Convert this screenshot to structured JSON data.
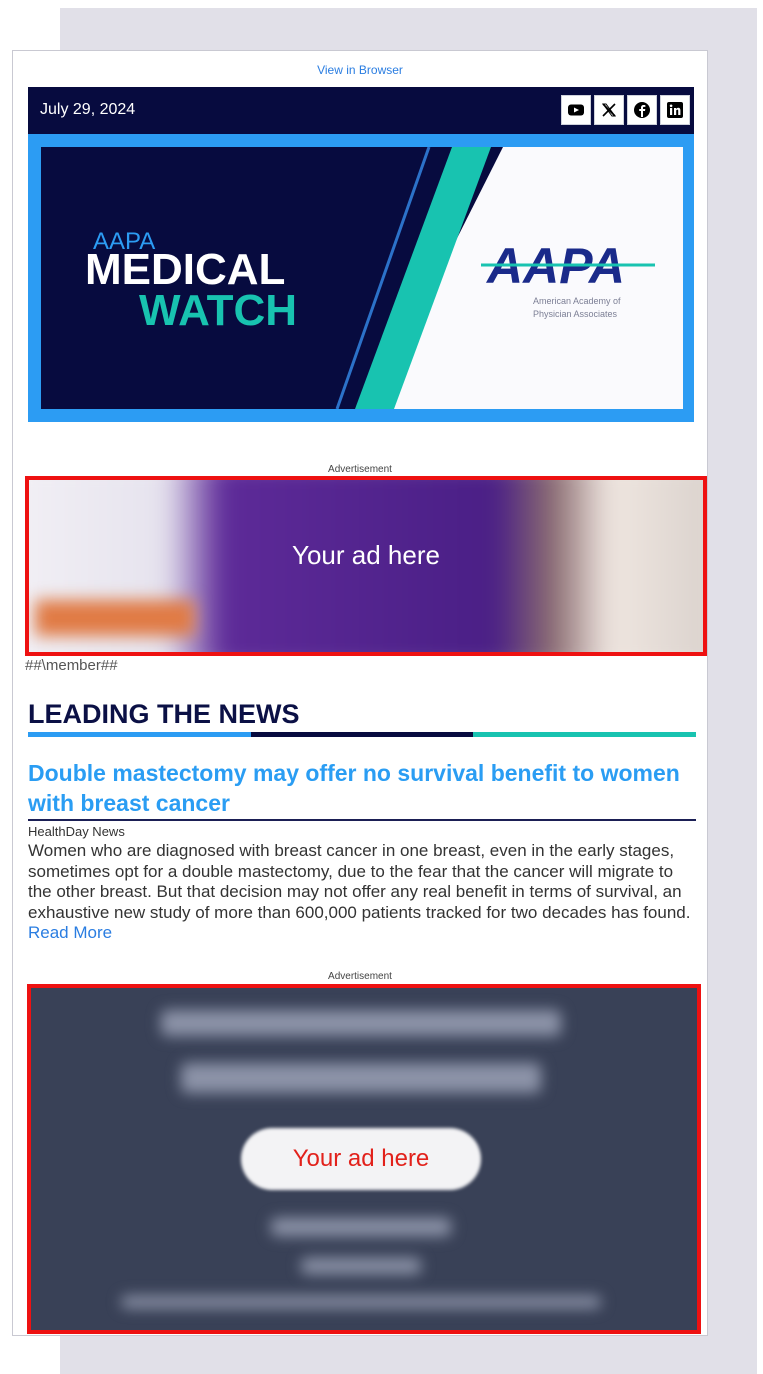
{
  "header": {
    "view_in_browser": "View in Browser",
    "date": "July 29, 2024",
    "social": [
      "youtube-icon",
      "x-icon",
      "facebook-icon",
      "linkedin-icon"
    ]
  },
  "banner": {
    "aapa_small": "AAPA",
    "medical": "MEDICAL",
    "watch": "WATCH",
    "logo": "AAPA",
    "org_line1": "American Academy of",
    "org_line2": "Physician Associates"
  },
  "ads": {
    "label": "Advertisement",
    "ad1_text": "Your ad here",
    "ad2_text": "Your ad here"
  },
  "member_tag": "##\\member##",
  "section": {
    "title": "LEADING THE NEWS"
  },
  "article": {
    "headline": "Double mastectomy may offer no survival benefit to women with breast cancer",
    "source": "HealthDay News",
    "body": "Women who are diagnosed with breast cancer in one breast, even in the early stages, sometimes opt for a double mastectomy, due to the fear that the cancer will migrate to the other breast. But that decision may not offer any real benefit in terms of survival, an exhaustive new study of more than 600,000 patients tracked for two decades has found.",
    "read_more": "Read More"
  },
  "colors": {
    "navy": "#070b3f",
    "blue": "#2c9cf3",
    "teal": "#18c3b0",
    "ad_border": "#ee1111"
  }
}
